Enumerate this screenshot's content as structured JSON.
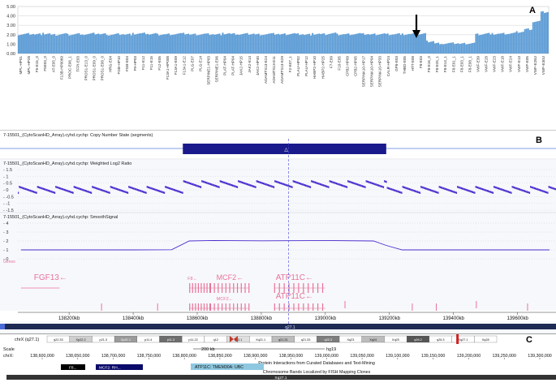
{
  "panel_labels": {
    "a": "A",
    "b": "B",
    "c": "C"
  },
  "chart_data": [
    {
      "type": "bar",
      "panel": "A",
      "ylim": [
        0,
        5
      ],
      "ytick_labels": [
        "0.00",
        "1.00",
        "2.00",
        "3.00",
        "4.00",
        "5.00"
      ],
      "grid": true,
      "categories": [
        "MPL-HP01",
        "MPL-HP28",
        "F5-E15_0",
        "F5E03_0",
        "AT-E05_0",
        "F13B-HP0069",
        "PROC-E06_1",
        "TFPI-E03",
        "PROS1-E13_0",
        "PROS1-E09_0",
        "PROS1-E08_0",
        "HRG-E04",
        "FGB-HP10",
        "FGB-E04",
        "F9-HP03",
        "F11-E12",
        "F11-E15",
        "F12-E05",
        "F13A1-HP008",
        "F13A1-E09",
        "F13A1-E12",
        "PLG-E07",
        "PLG-E14",
        "SERPINE1-HP03",
        "SERPINE1-E06",
        "PLAT-HP04",
        "PLAT-HP04",
        "JAK2-HP15",
        "JAK2-E14",
        "JAK2-HP40",
        "ADAMTS13-E24",
        "ADAMTS13-E11",
        "ADAMTS13-E29",
        "F2-E07_1",
        "PLAU-HP02",
        "PLAU-HP12",
        "HABP2-HP10",
        "HABP2-HP25",
        "F7-E09",
        "F10-E05",
        "CPB2-HP09",
        "CPB2-HP05",
        "SERPINA10-HP17",
        "SERPINA10-HP04",
        "SERPINA10-HP33",
        "CALR-HP24",
        "GP6-E03",
        "THBD-E05",
        "HTT-E08",
        "F8-E03",
        "F8-E16_0",
        "F8-E25_1",
        "F8-E14_1",
        "F8-E01_1",
        "F8-E03_1",
        "F8-E08_1",
        "VWF-E39",
        "VWF-E28",
        "VWF-E23",
        "VWF-E18",
        "VWF-E24",
        "VWF-E13",
        "VWF-E05",
        "VWF-E28U",
        "VWF-E30U"
      ],
      "values": [
        2.04,
        2.1,
        2.06,
        2.11,
        1.98,
        2.07,
        2.02,
        2.09,
        2.05,
        2.12,
        2.06,
        2.01,
        2.08,
        2.04,
        2.1,
        2.13,
        2.07,
        2.03,
        2.05,
        2.09,
        2.11,
        2.02,
        2.06,
        2.08,
        2.04,
        2.12,
        2.07,
        2.05,
        2.1,
        2.03,
        2.06,
        2.09,
        2.04,
        2.11,
        2.07,
        2.02,
        2.08,
        2.05,
        2.13,
        2.04,
        2.06,
        2.1,
        2.07,
        2.03,
        2.09,
        2.05,
        2.08,
        2.04,
        2.06,
        2.07,
        1.3,
        1.08,
        1.06,
        1.09,
        1.04,
        1.1,
        2.05,
        2.12,
        2.08,
        2.1,
        2.14,
        2.3,
        2.6,
        3.4,
        4.4
      ],
      "annotation": "arrow-marker"
    },
    {
      "type": "line",
      "panel": "B",
      "tracks": [
        {
          "title": "7-15501_(CytoScanHD_Array).cyhd.cychp: Copy Number State (segments)"
        },
        {
          "title": "7-15501_(CytoScanHD_Array).cyhd.cychp: Weighted Log2 Ratio",
          "ytick_labels": [
            "1.5",
            "1",
            "0.5",
            "0",
            "-0.5",
            "-1",
            "-1.5"
          ]
        },
        {
          "title": "7-15501_(CytoScanHD_Array).cyhd.cychp: SmoothSignal",
          "ytick_labels": [
            "4",
            "3",
            "2",
            "1",
            "0"
          ]
        }
      ],
      "genes_label": "Genes",
      "gene_names": [
        "FGF13",
        "F8",
        "MCF2",
        "ATP11C",
        "MCF2",
        "ATP11C"
      ],
      "x_tick_labels": [
        "138200kb",
        "138400kb",
        "138600kb",
        "138800kb",
        "139000kb",
        "139200kb",
        "139400kb",
        "139600kb"
      ],
      "x": [
        138200,
        138400,
        138600,
        138800,
        139000,
        139200,
        139400,
        139600
      ],
      "gain_region_kb": [
        138555,
        139190
      ],
      "smooth_signal": {
        "x": [
          138050,
          138200,
          138400,
          138520,
          138575,
          138650,
          138800,
          139000,
          139150,
          139190,
          139240,
          139400,
          139700
        ],
        "y": [
          1.0,
          1.0,
          1.0,
          1.02,
          2.0,
          2.05,
          2.02,
          2.05,
          2.0,
          1.5,
          1.0,
          1.0,
          1.0
        ]
      },
      "weighted_log2": {
        "baseline": 0.0,
        "gain_level": 0.42
      },
      "cytoband_label": "q27.1"
    },
    {
      "type": "table",
      "panel": "C",
      "chromosome_label": "chrX (q27.1)",
      "bands": [
        "q22.33",
        "Xp22.2",
        "p21.3",
        "Xp21.1",
        "p11.4",
        "p11.3",
        "p11.22",
        "q12",
        "q13.1",
        "Xq21.1",
        "q21.31",
        "q21.33",
        "q22.3",
        "Xq23",
        "Xq24",
        "Xq25",
        "q26.2",
        "q26.3",
        "Xq27.1",
        "Xq28"
      ],
      "scale_label": "Scale",
      "chr_label": "chrX:",
      "scale_bar": "200 kb",
      "assembly": "hg19",
      "positions": [
        "138,600,000",
        "138,650,000",
        "138,700,000",
        "138,750,000",
        "138,800,000",
        "138,850,000",
        "138,900,000",
        "138,950,000",
        "139,000,000",
        "139,050,000",
        "139,100,000",
        "139,150,000",
        "139,200,000",
        "139,250,000",
        "139,300,000"
      ],
      "track_title_1": "Protein Interactions from Curated Databases and Text-Mining",
      "genes": [
        "F8...",
        "MCF2: RH...",
        "ATP11C: TMEM30A: UBC"
      ],
      "track_title_2": "Chromosome Bands Localized by FISH Mapping Clones",
      "band_label": "Xq27.1"
    }
  ],
  "colors": {
    "bar": "#5b9bd5",
    "probe": "#4a2ccf",
    "segment": "#1a1a8c",
    "gene": "#e8739a",
    "dashed": "#4a4adb"
  }
}
